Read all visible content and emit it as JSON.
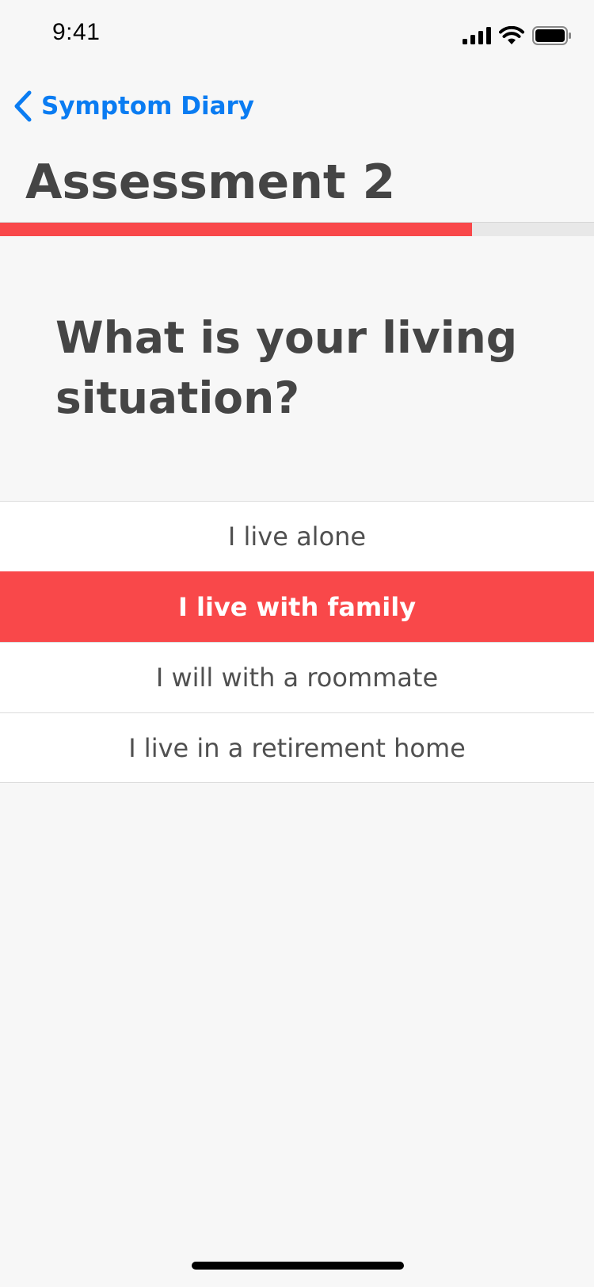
{
  "status_bar": {
    "time": "9:41"
  },
  "nav": {
    "back_label": "Symptom Diary",
    "accent_color": "#0a7cf2"
  },
  "page": {
    "title": "Assessment 2",
    "progress_fraction": 0.795,
    "progress_color": "#f9484a"
  },
  "question": {
    "text": "What is your living situation?"
  },
  "options": [
    {
      "label": "I live alone",
      "selected": false
    },
    {
      "label": "I live with family",
      "selected": true
    },
    {
      "label": "I will with a roommate",
      "selected": false
    },
    {
      "label": "I live in a retirement home",
      "selected": false
    }
  ],
  "icons": {
    "back": "chevron-left-icon",
    "signal": "cellular-signal-icon",
    "wifi": "wifi-icon",
    "battery": "battery-icon"
  }
}
